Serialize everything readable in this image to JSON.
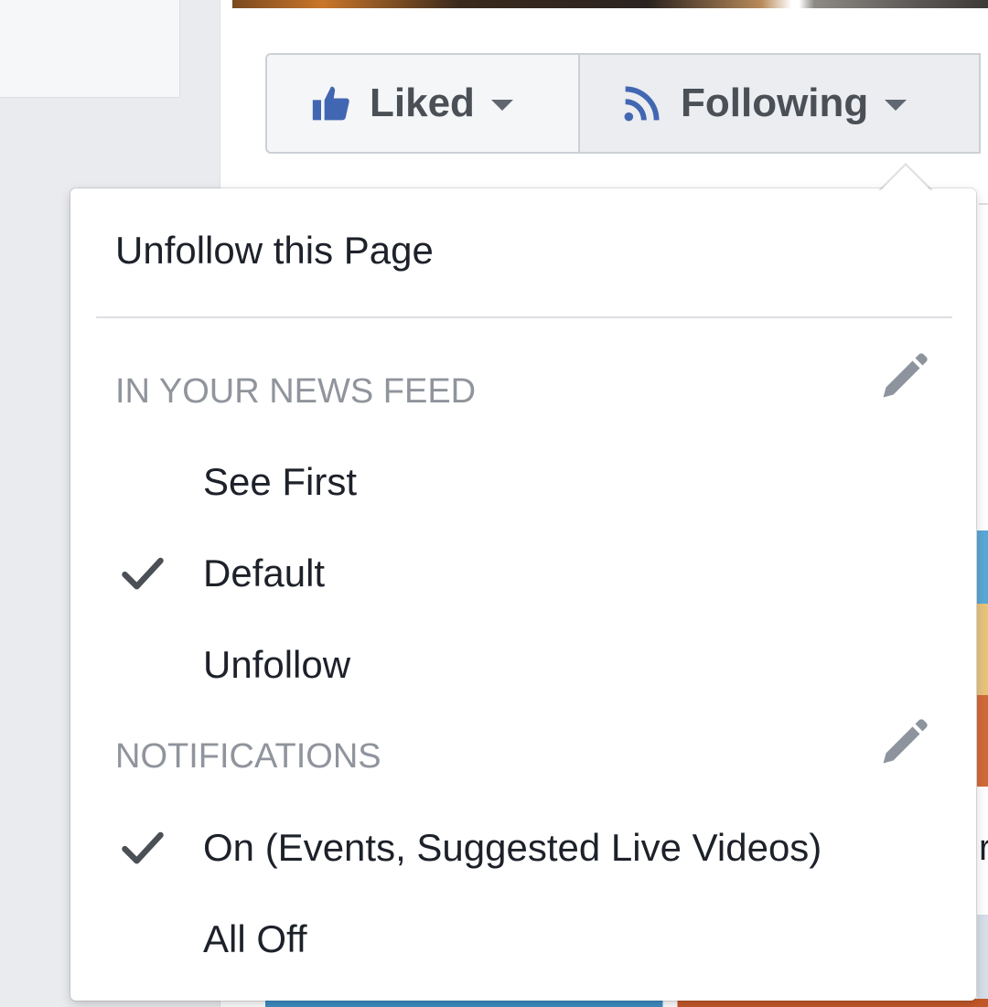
{
  "page_actions": {
    "liked_label": "Liked",
    "following_label": "Following"
  },
  "menu": {
    "unfollow_page": "Unfollow this Page",
    "news_feed": {
      "header": "IN YOUR NEWS FEED",
      "options": [
        {
          "label": "See First",
          "selected": false
        },
        {
          "label": "Default",
          "selected": true
        },
        {
          "label": "Unfollow",
          "selected": false
        }
      ]
    },
    "notifications": {
      "header": "NOTIFICATIONS",
      "options": [
        {
          "label": "On (Events, Suggested Live Videos)",
          "selected": true
        },
        {
          "label": "All Off",
          "selected": false
        }
      ]
    }
  },
  "background": {
    "edge_text": "r"
  },
  "colors": {
    "like_blue": "#4267b2",
    "text_primary": "#1d2129",
    "text_secondary": "#90949c",
    "icon_gray": "#606770"
  },
  "icons": [
    "thumbs-up-icon",
    "rss-feed-icon",
    "chevron-down-icon",
    "pencil-icon",
    "checkmark-icon"
  ]
}
